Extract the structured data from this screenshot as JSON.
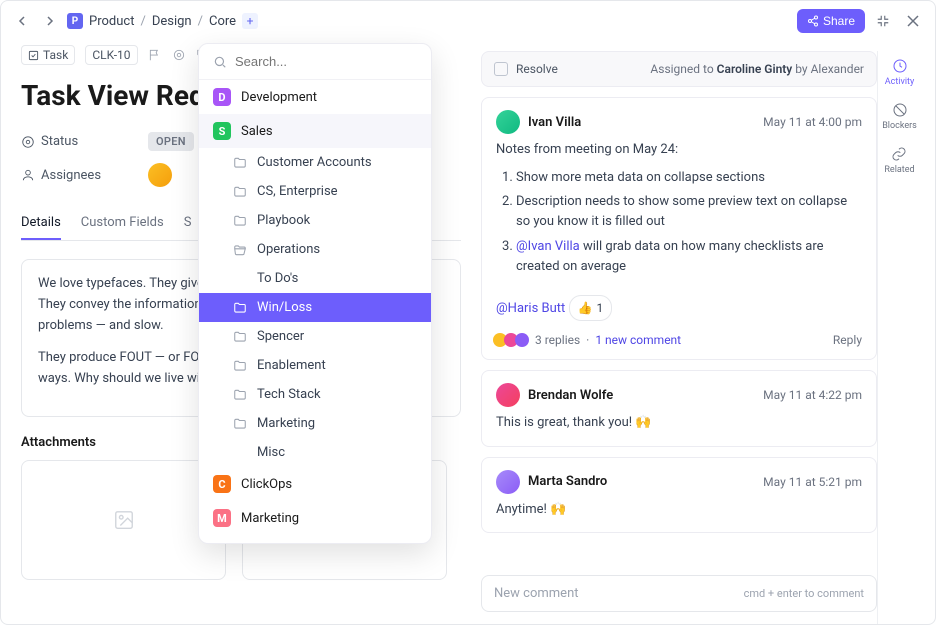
{
  "breadcrumbs": {
    "icon_letter": "P",
    "items": [
      "Product",
      "Design",
      "Core"
    ]
  },
  "share_label": "Share",
  "toolbar": {
    "task_label": "Task",
    "task_id": "CLK-10"
  },
  "title": "Task View Red",
  "meta": {
    "status_label": "Status",
    "status_value": "OPEN",
    "assignees_label": "Assignees"
  },
  "tabs": {
    "details": "Details",
    "custom": "Custom Fields",
    "subtasks": "S"
  },
  "description": {
    "p1": "We love typefaces. They give our sites personality and a visual vibe. They convey the information hierarchy. But they're also full of problems — and slow.",
    "p2": "They produce FOUT — or FOIT — either way, it's bad in all sorts of ways. Why should we live wit"
  },
  "attachments_label": "Attachments",
  "dropdown": {
    "search_placeholder": "Search...",
    "groups": [
      {
        "label": "Development",
        "color": "dev",
        "letter": "D"
      },
      {
        "label": "Sales",
        "color": "sales",
        "letter": "S",
        "selected": true,
        "items": [
          {
            "label": "Customer Accounts",
            "icon": "folder"
          },
          {
            "label": "CS, Enterprise",
            "icon": "folder"
          },
          {
            "label": "Playbook",
            "icon": "folder"
          },
          {
            "label": "Operations",
            "icon": "folder-open"
          },
          {
            "label": "To Do's",
            "icon": "none"
          },
          {
            "label": "Win/Loss",
            "icon": "folder",
            "selected": true
          },
          {
            "label": "Spencer",
            "icon": "folder"
          },
          {
            "label": "Enablement",
            "icon": "folder"
          },
          {
            "label": "Tech Stack",
            "icon": "folder"
          },
          {
            "label": "Marketing",
            "icon": "folder"
          },
          {
            "label": "Misc",
            "icon": "none"
          }
        ]
      },
      {
        "label": "ClickOps",
        "color": "click",
        "letter": "C"
      },
      {
        "label": "Marketing",
        "color": "mkt",
        "letter": "M"
      }
    ]
  },
  "resolve": {
    "label": "Resolve",
    "assigned_prefix": "Assigned to ",
    "assignee": "Caroline Ginty",
    "by_prefix": " by ",
    "creator": "Alexander"
  },
  "comments": [
    {
      "author": "Ivan Villa",
      "time": "May 11 at 4:00 pm",
      "intro": "Notes from meeting on May 24:",
      "list": [
        "Show more meta data on collapse sections",
        "Description needs to show some preview text on collapse so you know it is filled out",
        {
          "mention": "@Ivan Villa",
          "rest": " will grab data on how many checklists are created on average"
        }
      ],
      "tail_mention": "@Haris Butt",
      "reaction_emoji": "👍",
      "reaction_count": "1",
      "replies": "3 replies",
      "new": "1 new comment",
      "reply_label": "Reply"
    },
    {
      "author": "Brendan Wolfe",
      "time": "May 11 at 4:22 pm",
      "body": "This is great, thank you! 🙌"
    },
    {
      "author": "Marta Sandro",
      "time": "May 11 at 5:21 pm",
      "body": "Anytime! 🙌"
    }
  ],
  "composer": {
    "placeholder": "New comment",
    "hint": "cmd + enter to comment"
  },
  "rail": {
    "activity": "Activity",
    "blockers": "Blockers",
    "related": "Related"
  }
}
